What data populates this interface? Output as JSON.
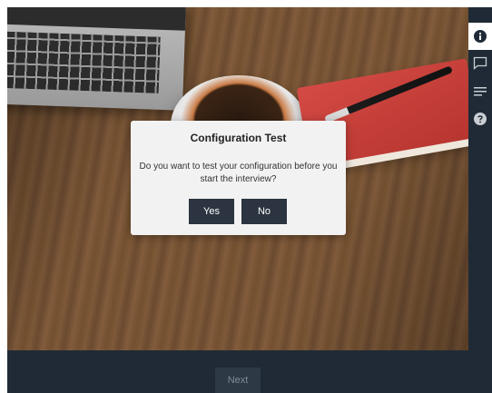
{
  "dialog": {
    "title": "Configuration Test",
    "message": "Do you want to test your configuration before you start the interview?",
    "yes_label": "Yes",
    "no_label": "No"
  },
  "footer": {
    "next_label": "Next"
  },
  "side_rail": {
    "items": [
      {
        "icon": "info-icon",
        "active": true
      },
      {
        "icon": "chat-icon",
        "active": false
      },
      {
        "icon": "list-icon",
        "active": false
      },
      {
        "icon": "help-icon",
        "active": false
      }
    ]
  },
  "colors": {
    "dark_bar": "#1f2a36",
    "button_bg": "#2b3440",
    "dialog_bg": "#f2f2f2"
  }
}
